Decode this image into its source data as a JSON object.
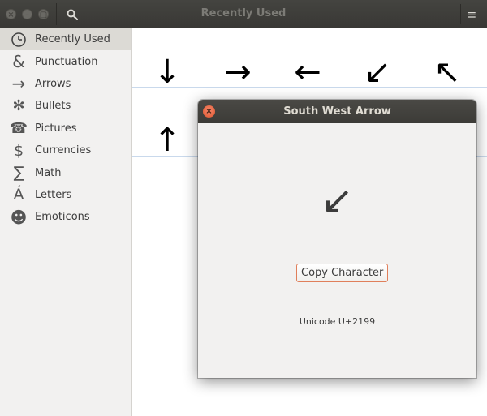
{
  "window": {
    "title": "Recently Used",
    "close_glyph": "×",
    "minimize_glyph": "–",
    "maximize_glyph": "▢",
    "menu_glyph": "≡"
  },
  "sidebar": {
    "items": [
      {
        "label": "Recently Used",
        "icon": "clock-icon",
        "glyph": "🕓",
        "selected": true
      },
      {
        "label": "Punctuation",
        "icon": "ampersand-icon",
        "glyph": "&",
        "selected": false
      },
      {
        "label": "Arrows",
        "icon": "right-arrow-icon",
        "glyph": "→",
        "selected": false
      },
      {
        "label": "Bullets",
        "icon": "asterisk-bullet-icon",
        "glyph": "✻",
        "selected": false
      },
      {
        "label": "Pictures",
        "icon": "telephone-icon",
        "glyph": "☎",
        "selected": false
      },
      {
        "label": "Currencies",
        "icon": "dollar-icon",
        "glyph": "$",
        "selected": false
      },
      {
        "label": "Math",
        "icon": "sigma-icon",
        "glyph": "∑",
        "selected": false
      },
      {
        "label": "Letters",
        "icon": "a-acute-icon",
        "glyph": "Á",
        "selected": false
      },
      {
        "label": "Emoticons",
        "icon": "smiley-icon",
        "glyph": "☻",
        "selected": false
      }
    ]
  },
  "grid": {
    "characters": [
      {
        "char": "↓",
        "name": "down-arrow"
      },
      {
        "char": "→",
        "name": "right-arrow"
      },
      {
        "char": "←",
        "name": "left-arrow"
      },
      {
        "char": "↙",
        "name": "south-west-arrow"
      },
      {
        "char": "↖",
        "name": "north-west-arrow"
      },
      {
        "char": "↑",
        "name": "up-arrow"
      }
    ]
  },
  "dialog": {
    "title": "South West Arrow",
    "character": "↙",
    "copy_label": "Copy Character",
    "unicode": "Unicode U+2199",
    "close_glyph": "×"
  },
  "colors": {
    "headerbar": "#3c3b37",
    "close_button": "#e0552d",
    "selection": "#dcdad5",
    "gridline": "#c9d9ec"
  }
}
